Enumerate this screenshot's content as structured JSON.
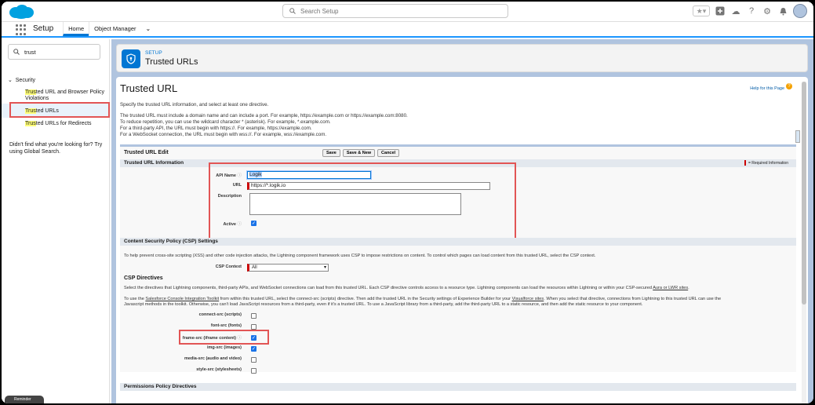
{
  "header": {
    "search_placeholder": "Search Setup"
  },
  "appbar": {
    "app_name": "Setup",
    "tabs": [
      {
        "label": "Home"
      },
      {
        "label": "Object Manager"
      }
    ]
  },
  "sidebar": {
    "quickfind_value": "trust",
    "group": "Security",
    "items": [
      {
        "hl": "Trus",
        "rest": "ted URL and Browser Policy Violations"
      },
      {
        "hl": "Trus",
        "rest": "ted URLs"
      },
      {
        "hl": "Trus",
        "rest": "ted URLs for Redirects"
      }
    ],
    "help_text": "Didn't find what you're looking for? Try using Global Search."
  },
  "setup_header": {
    "kicker": "SETUP",
    "title": "Trusted URLs"
  },
  "page": {
    "title": "Trusted URL",
    "help_link": "Help for this Page",
    "intro": "Specify the trusted URL information, and select at least one directive.",
    "notes": [
      "The trusted URL must include a domain name and can include a port. For example, https://example.com or https://example.com:8080.",
      "To reduce repetition, you can use the wildcard character * (asterisk). For example, *.example.com.",
      "For a third-party API, the URL must begin with https://. For example, https://example.com.",
      "For a WebSocket connection, the URL must begin with wss://. For example, wss://example.com."
    ]
  },
  "edit": {
    "title": "Trusted URL Edit",
    "buttons": {
      "save": "Save",
      "save_new": "Save & New",
      "cancel": "Cancel"
    },
    "info_section": "Trusted URL Information",
    "required_info": "= Required Information",
    "fields": {
      "api_name_label": "API Name",
      "api_name_value": "Logik",
      "url_label": "URL",
      "url_value": "https://*.logik.io",
      "description_label": "Description",
      "active_label": "Active"
    },
    "csp_section": "Content Security Policy (CSP) Settings",
    "csp_intro": "To help prevent cross-site scripting (XSS) and other code injection attacks, the Lightning component framework uses CSP to impose restrictions on content. To control which pages can load content from this trusted URL, select the CSP context.",
    "csp_context_label": "CSP Context",
    "csp_context_value": "All",
    "directives_title": "CSP Directives",
    "directives_intro_a": "Select the directives that Lightning components, third-party APIs, and WebSocket connections can load from this trusted URL. Each CSP directive controls access to a resource type. Lightning components can load the resources within Lightning or within your CSP-secured ",
    "directives_intro_link": "Aura or LWR sites",
    "directives_intro_b": ".",
    "console_a": "To use the ",
    "console_link": "Salesforce Console Integration Toolkit",
    "console_b": " from within this trusted URL, select the connect-src (scripts) directive. Then add the trusted URL in the Security settings of Experience Builder for your ",
    "console_link2": "Visualforce sites",
    "console_c": ". When you select that directive, connections from Lightning to this trusted URL can use the",
    "console_d": "Javascript methods in the toolkit. Otherwise, you can't load JavaScript resources from a third-party, even if it's a trusted URL. To use a JavaScript library from a third-party, add the third-party URL to a static resource, and then add the static resource to your component.",
    "directives": [
      {
        "label": "connect-src (scripts)",
        "checked": false
      },
      {
        "label": "font-src (fonts)",
        "checked": false
      },
      {
        "label": "frame-src (iframe content)",
        "checked": true
      },
      {
        "label": "img-src (images)",
        "checked": true
      },
      {
        "label": "media-src (audio and video)",
        "checked": false
      },
      {
        "label": "style-src (stylesheets)",
        "checked": false
      }
    ],
    "permissions_section": "Permissions Policy Directives"
  },
  "footer": {
    "pill": "Reminder"
  },
  "colors": {
    "brand": "#0176d3",
    "highlight_box": "#e25555"
  }
}
